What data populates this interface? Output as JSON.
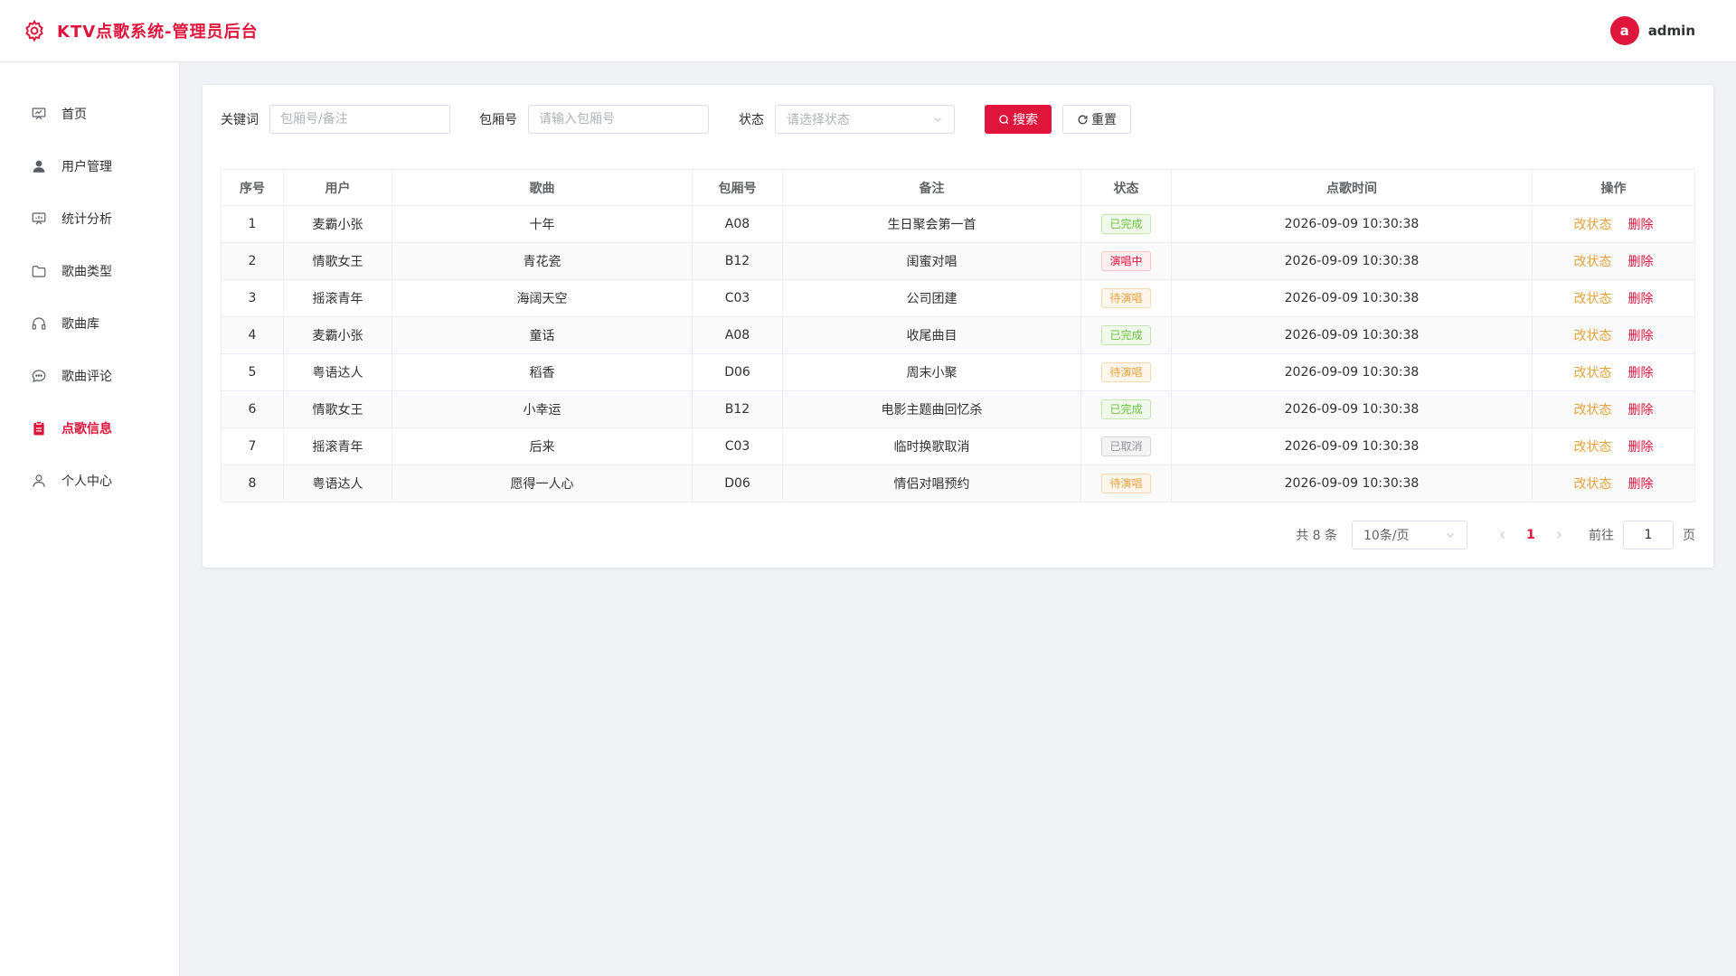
{
  "header": {
    "title": "KTV点歌系统-管理员后台",
    "avatar_letter": "a",
    "username": "admin"
  },
  "colors": {
    "accent": "#e0153c",
    "warning": "#e6a23c",
    "success": "#67c23a",
    "info": "#909399"
  },
  "sidebar": {
    "items": [
      {
        "label": "首页",
        "icon": "presentation-icon",
        "active": false
      },
      {
        "label": "用户管理",
        "icon": "user-icon",
        "active": false
      },
      {
        "label": "统计分析",
        "icon": "chart-board-icon",
        "active": false
      },
      {
        "label": "歌曲类型",
        "icon": "folder-icon",
        "active": false
      },
      {
        "label": "歌曲库",
        "icon": "headphones-icon",
        "active": false
      },
      {
        "label": "歌曲评论",
        "icon": "chat-bubble-icon",
        "active": false
      },
      {
        "label": "点歌信息",
        "icon": "clipboard-icon",
        "active": true
      },
      {
        "label": "个人中心",
        "icon": "person-outline-icon",
        "active": false
      }
    ]
  },
  "filters": {
    "keyword_label": "关键词",
    "keyword_placeholder": "包厢号/备注",
    "room_label": "包厢号",
    "room_placeholder": "请输入包厢号",
    "status_label": "状态",
    "status_placeholder": "请选择状态",
    "search_label": "搜索",
    "reset_label": "重置"
  },
  "table": {
    "columns": [
      "序号",
      "用户",
      "歌曲",
      "包厢号",
      "备注",
      "状态",
      "点歌时间",
      "操作"
    ],
    "edit_label": "改状态",
    "delete_label": "删除",
    "rows": [
      {
        "index": "1",
        "user": "麦霸小张",
        "song": "十年",
        "room": "A08",
        "note": "生日聚会第一首",
        "status": "已完成",
        "status_type": "success",
        "time": "2026-09-09 10:30:38"
      },
      {
        "index": "2",
        "user": "情歌女王",
        "song": "青花瓷",
        "room": "B12",
        "note": "闺蜜对唱",
        "status": "演唱中",
        "status_type": "danger",
        "time": "2026-09-09 10:30:38"
      },
      {
        "index": "3",
        "user": "摇滚青年",
        "song": "海阔天空",
        "room": "C03",
        "note": "公司团建",
        "status": "待演唱",
        "status_type": "warning",
        "time": "2026-09-09 10:30:38"
      },
      {
        "index": "4",
        "user": "麦霸小张",
        "song": "童话",
        "room": "A08",
        "note": "收尾曲目",
        "status": "已完成",
        "status_type": "success",
        "time": "2026-09-09 10:30:38"
      },
      {
        "index": "5",
        "user": "粤语达人",
        "song": "稻香",
        "room": "D06",
        "note": "周末小聚",
        "status": "待演唱",
        "status_type": "warning",
        "time": "2026-09-09 10:30:38"
      },
      {
        "index": "6",
        "user": "情歌女王",
        "song": "小幸运",
        "room": "B12",
        "note": "电影主题曲回忆杀",
        "status": "已完成",
        "status_type": "success",
        "time": "2026-09-09 10:30:38"
      },
      {
        "index": "7",
        "user": "摇滚青年",
        "song": "后来",
        "room": "C03",
        "note": "临时换歌取消",
        "status": "已取消",
        "status_type": "info",
        "time": "2026-09-09 10:30:38"
      },
      {
        "index": "8",
        "user": "粤语达人",
        "song": "愿得一人心",
        "room": "D06",
        "note": "情侣对唱预约",
        "status": "待演唱",
        "status_type": "warning",
        "time": "2026-09-09 10:30:38"
      }
    ]
  },
  "pagination": {
    "total_text": "共 8 条",
    "page_size": "10条/页",
    "current_page": "1",
    "goto_label": "前往",
    "goto_value": "1",
    "page_unit": "页"
  }
}
